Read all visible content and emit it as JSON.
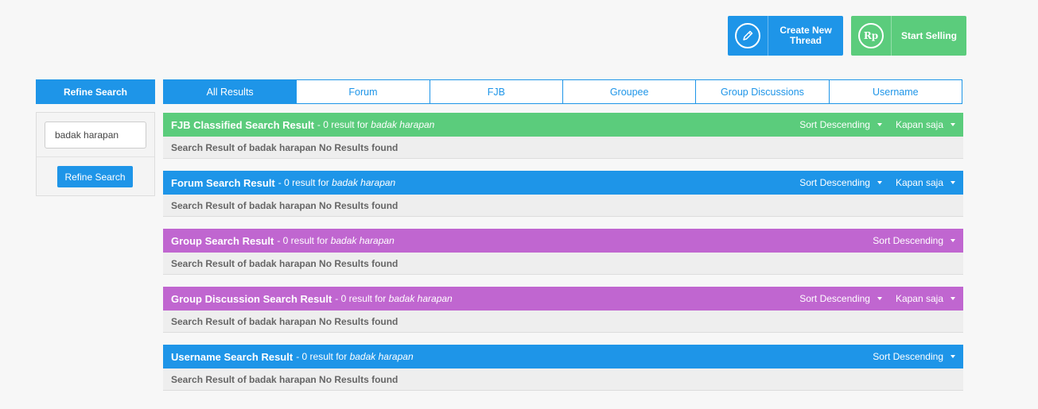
{
  "top_buttons": {
    "create_line1": "Create New",
    "create_line2": "Thread",
    "sell_label": "Start Selling",
    "sell_icon_text": "Rp"
  },
  "refine": {
    "title": "Refine Search",
    "input_value": "badak harapan",
    "button_label": "Refine Search"
  },
  "tabs": [
    "All Results",
    "Forum",
    "FJB",
    "Groupee",
    "Group Discussions",
    "Username"
  ],
  "sections": [
    {
      "title": "FJB Classified Search Result",
      "meta": "- 0 result for",
      "query": "badak harapan",
      "sort": "Sort Descending",
      "time": "Kapan saja",
      "body": "Search Result of badak harapan No Results found",
      "color": "#5bcc7c"
    },
    {
      "title": "Forum Search Result",
      "meta": "- 0 result for",
      "query": "badak harapan",
      "sort": "Sort Descending",
      "time": "Kapan saja",
      "body": "Search Result of badak harapan No Results found",
      "color": "#1e95e8"
    },
    {
      "title": "Group Search Result",
      "meta": "- 0 result for",
      "query": "badak harapan",
      "sort": "Sort Descending",
      "body": "Search Result of badak harapan No Results found",
      "color": "#c066d0"
    },
    {
      "title": "Group Discussion Search Result",
      "meta": "- 0 result for",
      "query": "badak harapan",
      "sort": "Sort Descending",
      "time": "Kapan saja",
      "body": "Search Result of badak harapan No Results found",
      "color": "#c066d0"
    },
    {
      "title": "Username Search Result",
      "meta": "- 0 result for",
      "query": "badak harapan",
      "sort": "Sort Descending",
      "body": "Search Result of badak harapan No Results found",
      "color": "#1e95e8"
    }
  ]
}
